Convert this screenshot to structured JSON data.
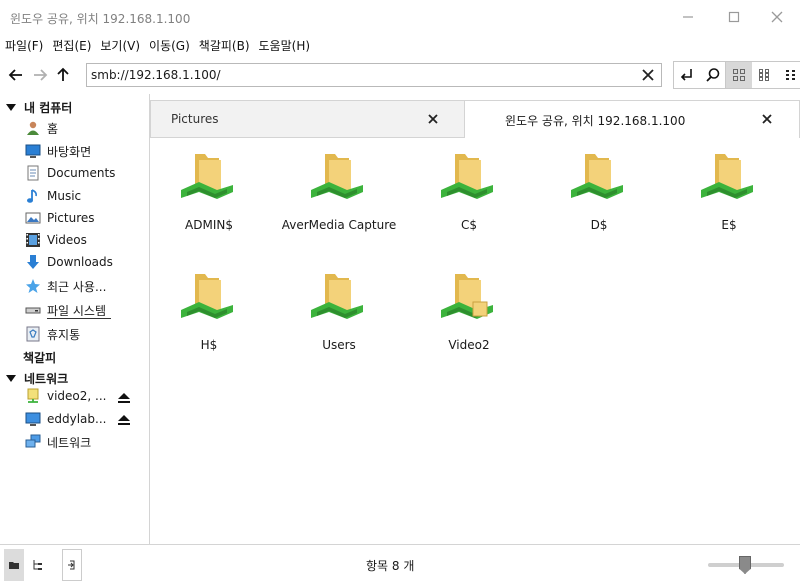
{
  "window": {
    "title": "윈도우 공유, 위치 192.168.1.100"
  },
  "menu": [
    "파일(F)",
    "편집(E)",
    "보기(V)",
    "이동(G)",
    "책갈피(B)",
    "도움말(H)"
  ],
  "address": {
    "value": "smb://192.168.1.100/"
  },
  "sidebar": {
    "sections": {
      "computer": "내 컴퓨터",
      "bookmarks": "책갈피",
      "network": "네트워크"
    },
    "computer_items": [
      {
        "label": "홈",
        "icon": "home-icon"
      },
      {
        "label": "바탕화면",
        "icon": "desktop-icon"
      },
      {
        "label": "Documents",
        "icon": "documents-icon"
      },
      {
        "label": "Music",
        "icon": "music-icon"
      },
      {
        "label": "Pictures",
        "icon": "pictures-icon"
      },
      {
        "label": "Videos",
        "icon": "videos-icon"
      },
      {
        "label": "Downloads",
        "icon": "downloads-icon"
      },
      {
        "label": "최근 사용...",
        "icon": "recent-icon"
      },
      {
        "label": "파일 시스템",
        "icon": "drive-icon"
      },
      {
        "label": "휴지통",
        "icon": "trash-icon"
      }
    ],
    "network_items": [
      {
        "label": "video2, ...",
        "icon": "network-share-icon",
        "eject": true
      },
      {
        "label": "eddylab...",
        "icon": "computer-icon",
        "eject": true
      },
      {
        "label": "네트워크",
        "icon": "network-icon",
        "eject": false
      }
    ]
  },
  "tabs": [
    {
      "label": "Pictures",
      "active": false
    },
    {
      "label": "윈도우 공유, 위치 192.168.1.100",
      "active": true
    }
  ],
  "files": [
    {
      "name": "ADMIN$",
      "badge": false
    },
    {
      "name": "AverMedia Capture",
      "badge": false
    },
    {
      "name": "C$",
      "badge": false
    },
    {
      "name": "D$",
      "badge": false
    },
    {
      "name": "E$",
      "badge": false
    },
    {
      "name": "H$",
      "badge": false
    },
    {
      "name": "Users",
      "badge": false
    },
    {
      "name": "Video2",
      "badge": true
    }
  ],
  "status": {
    "text": "항목 8 개",
    "zoom_fraction": 0.48
  },
  "colors": {
    "folder": "#f3d27a",
    "folder_dark": "#e2b84e",
    "share_green": "#3cb33c",
    "accent_blue": "#2a7fd4"
  }
}
